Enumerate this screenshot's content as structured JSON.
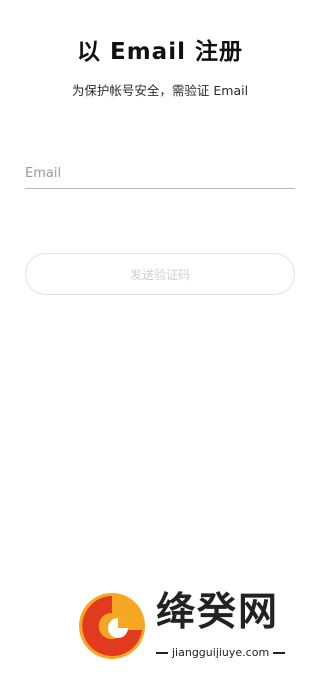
{
  "header": {
    "title": "以 Email 注册",
    "subtitle": "为保护帐号安全，需验证 Email"
  },
  "form": {
    "email_value": "",
    "email_placeholder": "Email",
    "send_code_label": "发送验证码"
  },
  "watermark": {
    "name": "绛癸网",
    "url": "jiangguijiuye.com",
    "logo_colors": {
      "primary": "#e23a1e",
      "secondary": "#f5a623"
    }
  },
  "colors": {
    "title": "#111111",
    "button_text_disabled": "#cfcfcf",
    "input_underline": "#b8b8b8"
  }
}
